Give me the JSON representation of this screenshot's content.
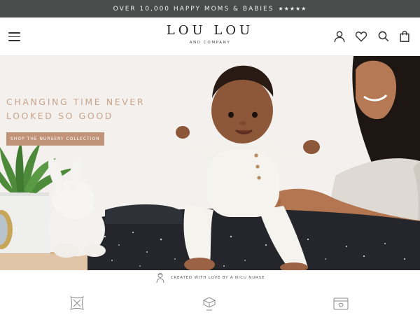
{
  "announcement": {
    "text": "OVER 10,000 HAPPY MOMS & BABIES",
    "stars": "★★★★★"
  },
  "header": {
    "logo_main": "LOU LOU",
    "logo_sub": "AND COMPANY",
    "icons": [
      "menu-icon",
      "account-icon",
      "heart-icon",
      "search-icon",
      "bag-icon"
    ]
  },
  "hero": {
    "heading_line1": "CHANGING TIME NEVER",
    "heading_line2": "LOOKED SO GOOD",
    "cta": "SHOP THE NURSERY COLLECTION"
  },
  "strip": {
    "text": "CREATED WITH LOVE BY A NICU NURSE",
    "icon": "nurse-icon"
  },
  "features": [
    "blanket-icon",
    "swaddle-icon",
    "changing-pad-icon"
  ],
  "colors": {
    "announcement_bg": "#4a4b4b",
    "accent_text": "#c9a48b",
    "cta_bg": "#c19379",
    "hero_bg": "#f4f1ee"
  }
}
